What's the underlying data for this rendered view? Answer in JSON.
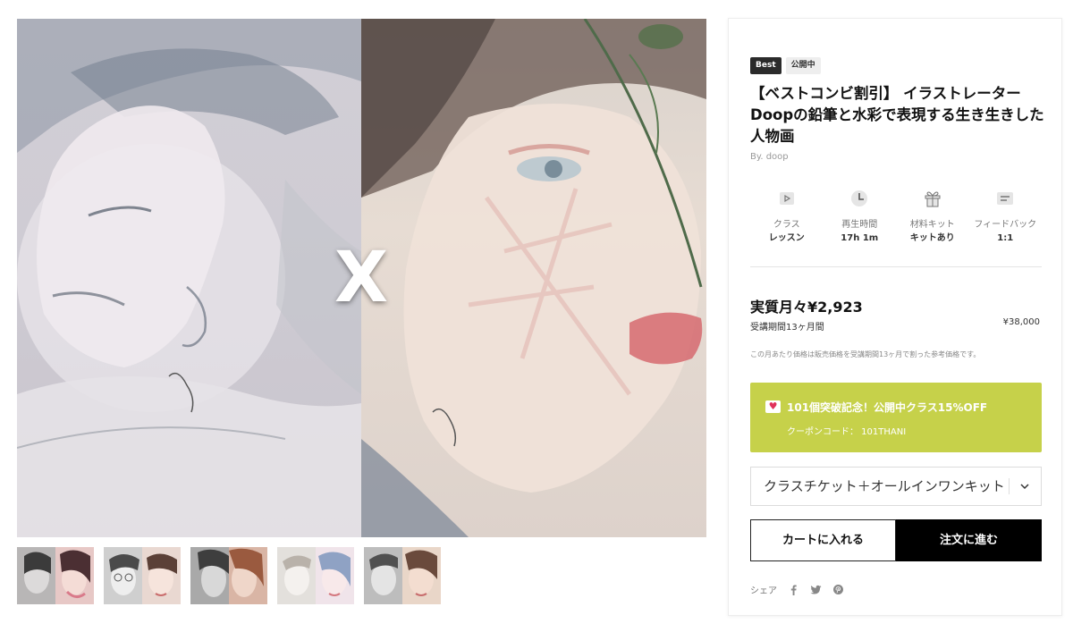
{
  "hero": {
    "separator": "X"
  },
  "thumbnails": [
    {
      "alt": "thumbnail-1"
    },
    {
      "alt": "thumbnail-2"
    },
    {
      "alt": "thumbnail-3"
    },
    {
      "alt": "thumbnail-4"
    },
    {
      "alt": "thumbnail-5"
    }
  ],
  "product": {
    "badges": [
      "Best",
      "公開中"
    ],
    "title": "【ベストコンビ割引】 イラストレーターDoopの鉛筆と水彩で表現する生き生きした人物画",
    "author": "By. doop",
    "stats": [
      {
        "icon": "play-icon",
        "label": "クラス",
        "value": "レッスン"
      },
      {
        "icon": "clock-icon",
        "label": "再生時間",
        "value": "17h 1m"
      },
      {
        "icon": "gift-icon",
        "label": "材料キット",
        "value": "キットあり"
      },
      {
        "icon": "feedback-icon",
        "label": "フィードバック",
        "value": "1:1"
      }
    ]
  },
  "price": {
    "monthly": "実質月々¥2,923",
    "period": "受講期間13ヶ月間",
    "total": "¥38,000",
    "note": "この月あたり価格は販売価格を受講期間13ヶ月で割った参考価格です。"
  },
  "promo": {
    "title": "101個突破記念！公開中クラス15%OFF",
    "code": "クーポンコード： 101THANI",
    "background": "#c6d14a"
  },
  "option_select": {
    "value": "クラスチケット＋オールインワンキット"
  },
  "actions": {
    "cart": "カートに入れる",
    "order": "注文に進む"
  },
  "share": {
    "label": "シェア",
    "icons": [
      "facebook-icon",
      "twitter-icon",
      "pinterest-icon"
    ]
  }
}
